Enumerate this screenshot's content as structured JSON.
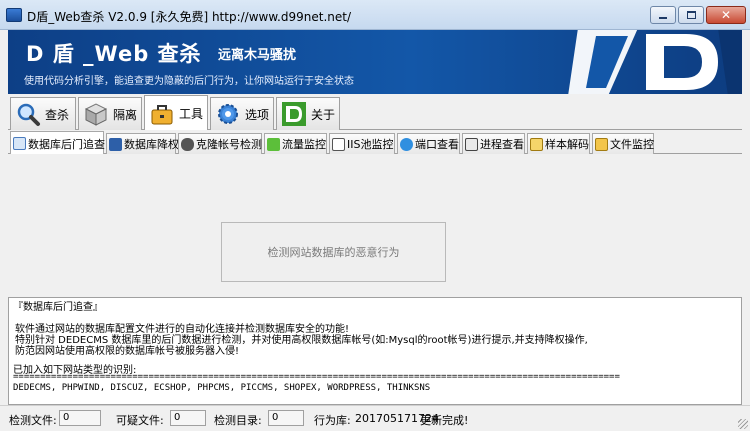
{
  "window": {
    "title": "D盾_Web查杀 V2.0.9 [永久免费] http://www.d99net.net/"
  },
  "banner": {
    "title": "D 盾 _Web 查杀",
    "subtitle": "远离木马骚扰",
    "description": "使用代码分析引擎，能追查更为隐蔽的后门行为，让你网站运行于安全状态",
    "colors": {
      "background": "#1357a8",
      "text": "#ffffff"
    }
  },
  "main_tabs": [
    {
      "label": "查杀",
      "icon": "magnifier-icon"
    },
    {
      "label": "隔离",
      "icon": "cabinet-icon"
    },
    {
      "label": "工具",
      "icon": "toolbox-icon",
      "active": true
    },
    {
      "label": "选项",
      "icon": "gear-icon"
    },
    {
      "label": "关于",
      "icon": "d-logo-icon"
    }
  ],
  "sub_tabs": [
    {
      "label": "数据库后门追查",
      "icon": "db-search-icon",
      "active": true
    },
    {
      "label": "数据库降权",
      "icon": "db-lower-icon"
    },
    {
      "label": "克隆帐号检测",
      "icon": "users-icon"
    },
    {
      "label": "流量监控",
      "icon": "traffic-icon"
    },
    {
      "label": "IIS池监控",
      "icon": "iis-pool-icon"
    },
    {
      "label": "端口查看",
      "icon": "globe-icon"
    },
    {
      "label": "进程查看",
      "icon": "process-icon"
    },
    {
      "label": "样本解码",
      "icon": "decode-icon"
    },
    {
      "label": "文件监控",
      "icon": "folder-icon"
    }
  ],
  "content": {
    "detect_button": "检测网站数据库的恶意行为",
    "info": {
      "heading": "『数据库后门追查』",
      "line1": "软件通过网站的数据库配置文件进行的自动化连接并检测数据库安全的功能!",
      "line2": "特别针对 DEDECMS 数据库里的后门数据进行检测，并对使用高权限数据库帐号(如:Mysql的root帐号)进行提示,并支持降权操作,",
      "line3": "防范因网站使用高权限的数据库帐号被服务器入侵!",
      "supported_label": "已加入如下网站类型的识别:",
      "separator": "================================================================================================================",
      "cms_list": "DEDECMS, PHPWIND, DISCUZ, ECSHOP, PHPCMS, PICCMS, SHOPEX, WORDPRESS, THINKSNS"
    }
  },
  "status": {
    "files_label": "检测文件:",
    "files_value": "0",
    "suspicious_label": "可疑文件:",
    "suspicious_value": "0",
    "dirs_label": "检测目录:",
    "dirs_value": "0",
    "rules_label": "行为库:",
    "rules_value": "201705171724",
    "update_text": "更新完成!"
  }
}
